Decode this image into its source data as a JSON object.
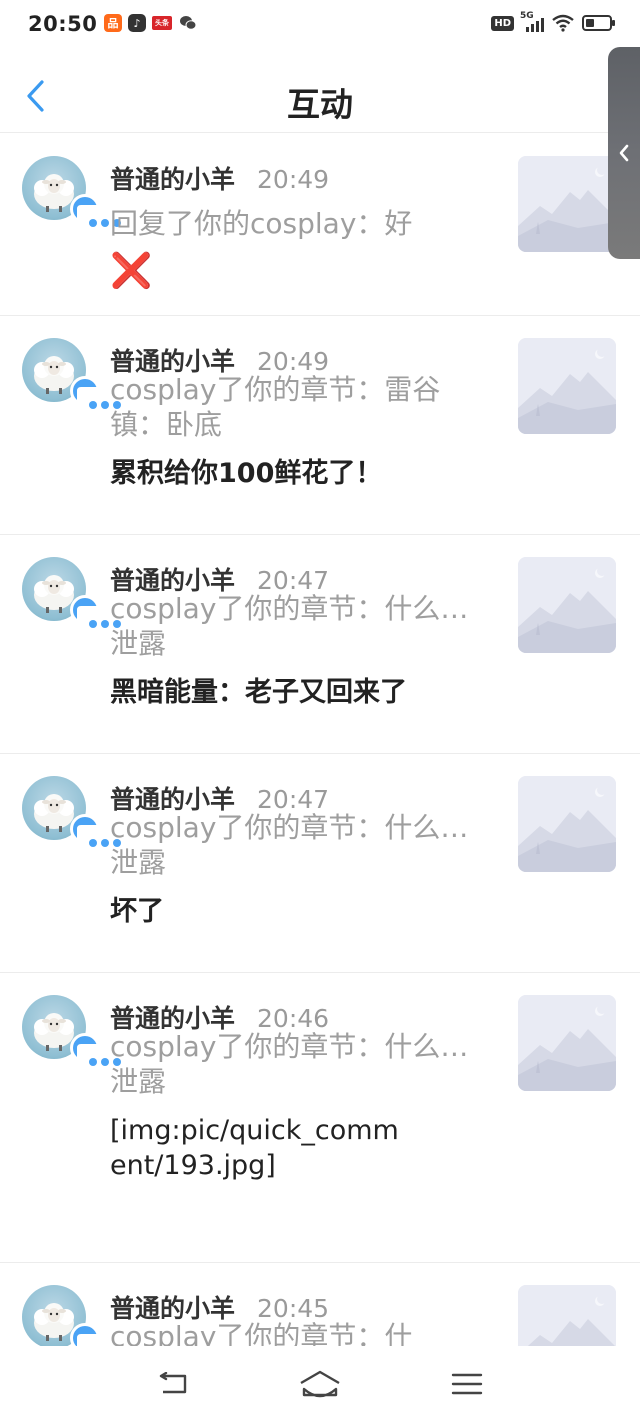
{
  "status_bar": {
    "time": "20:50",
    "notification_icons": [
      "app-icon-orange",
      "tiktok-icon",
      "toutiao-icon",
      "wechat-icon"
    ],
    "hd": "HD",
    "network": "5G"
  },
  "header": {
    "title": "互动"
  },
  "colors": {
    "accent": "#4aa3f5",
    "text_primary": "#222222",
    "text_secondary": "#9e9e9e",
    "divider": "#ececec"
  },
  "items": [
    {
      "username": "普通的小羊",
      "time": "20:49",
      "action": "回复了你的cosplay：好",
      "comment": "❌"
    },
    {
      "username": "普通的小羊",
      "time": "20:49",
      "action": "cosplay了你的章节：雷谷镇：卧底",
      "comment": "累积给你100鲜花了！"
    },
    {
      "username": "普通的小羊",
      "time": "20:47",
      "action": "cosplay了你的章节：什么…泄露",
      "comment": "黑暗能量：老子又回来了"
    },
    {
      "username": "普通的小羊",
      "time": "20:47",
      "action": "cosplay了你的章节：什么…泄露",
      "comment": "坏了"
    },
    {
      "username": "普通的小羊",
      "time": "20:46",
      "action": "cosplay了你的章节：什么…泄露",
      "comment": "[img:pic/quick_comment/193.jpg]"
    },
    {
      "username": "普通的小羊",
      "time": "20:45",
      "action": "cosplay了你的章节：什",
      "comment": ""
    }
  ]
}
